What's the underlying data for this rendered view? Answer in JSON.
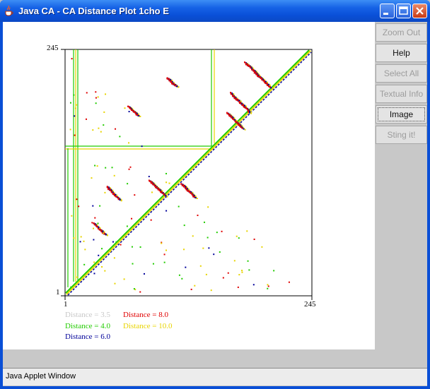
{
  "window": {
    "title": "Java CA - CA Distance Plot 1cho E"
  },
  "buttons": [
    {
      "label": "Zoom Out",
      "enabled": false
    },
    {
      "label": "Help",
      "enabled": true
    },
    {
      "label": "Select All",
      "enabled": false
    },
    {
      "label": "Textual Info",
      "enabled": false
    },
    {
      "label": "Image",
      "enabled": true
    },
    {
      "label": "Sting it!",
      "enabled": false
    }
  ],
  "plot": {
    "axis_max_y": "245",
    "axis_min_y": "1",
    "axis_min_x": "1",
    "axis_max_x": "245",
    "legend": [
      {
        "label": "Distance = 3.5",
        "color": "#c8c8c8"
      },
      {
        "label": "Distance = 8.0",
        "color": "#e00000"
      },
      {
        "label": "Distance = 4.0",
        "color": "#22cc00"
      },
      {
        "label": "Distance = 10.0",
        "color": "#e8d400"
      },
      {
        "label": "Distance = 6.0",
        "color": "#000099"
      }
    ]
  },
  "status_bar": {
    "text": "Java Applet Window"
  },
  "colors": {
    "titlebar": "#0a50d8",
    "panel": "#c8c8c8",
    "plot_bg": "#ffffff"
  }
}
